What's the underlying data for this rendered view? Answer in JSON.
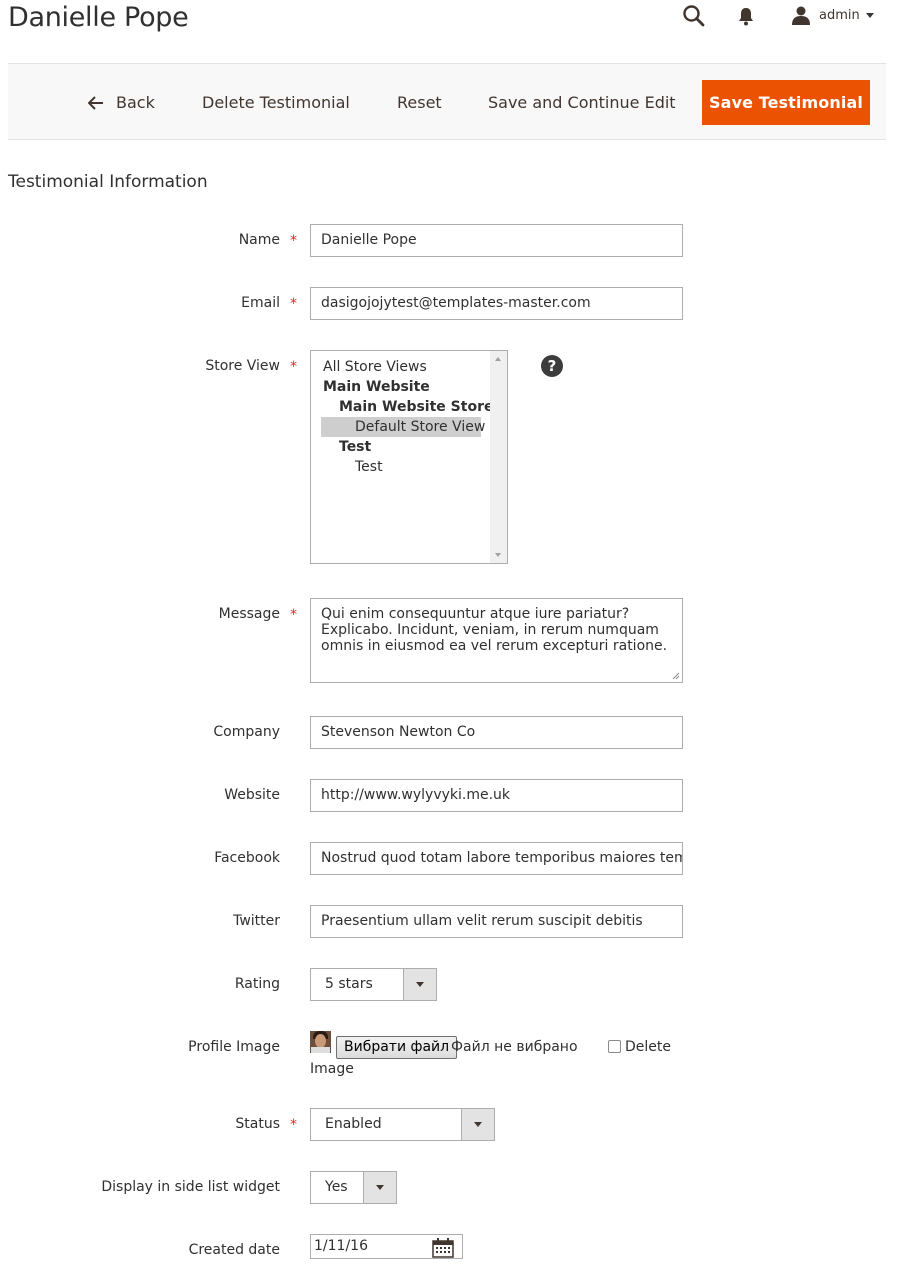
{
  "header": {
    "title": "Danielle Pope",
    "user_name": "admin",
    "icons": [
      "search-icon",
      "bell-icon",
      "user-icon"
    ]
  },
  "actions": {
    "back": "Back",
    "delete": "Delete Testimonial",
    "reset": "Reset",
    "save_continue": "Save and Continue Edit",
    "save": "Save Testimonial",
    "accent_color": "#eb5202"
  },
  "section": {
    "title": "Testimonial Information"
  },
  "form": {
    "name": {
      "label": "Name",
      "value": "Danielle Pope",
      "required": "*"
    },
    "email": {
      "label": "Email",
      "value": "dasigojojytest@templates-master.com",
      "required": "*"
    },
    "store_view": {
      "label": "Store View",
      "required": "*",
      "help": "?",
      "options": {
        "all": "All Store Views",
        "main_website": "Main Website",
        "main_website_store": "Main Website Store",
        "default_store_view": "Default Store View",
        "test_group": "Test",
        "test_view": "Test"
      },
      "selected": "Default Store View"
    },
    "message": {
      "label": "Message",
      "required": "*",
      "value": "Qui enim consequuntur atque iure pariatur? Explicabo. Incidunt, veniam, in rerum numquam omnis in eiusmod ea vel rerum excepturi ratione."
    },
    "company": {
      "label": "Company",
      "value": "Stevenson Newton Co"
    },
    "website": {
      "label": "Website",
      "value": "http://www.wylyvyki.me.uk"
    },
    "facebook": {
      "label": "Facebook",
      "value": "Nostrud quod totam labore temporibus maiores tem"
    },
    "twitter": {
      "label": "Twitter",
      "value": "Praesentium ullam velit rerum suscipit debitis"
    },
    "rating": {
      "label": "Rating",
      "value": "5 stars"
    },
    "profile_image": {
      "label": "Profile Image",
      "choose_button": "Вибрати файл",
      "file_status": "Файл не вибрано",
      "delete_label_1": "Delete",
      "delete_label_2": "Image",
      "delete_checked": false
    },
    "status": {
      "label": "Status",
      "value": "Enabled",
      "required": "*"
    },
    "side_list": {
      "label": "Display in side list widget",
      "value": "Yes"
    },
    "created_date": {
      "label": "Created date",
      "value": "1/11/16"
    }
  }
}
